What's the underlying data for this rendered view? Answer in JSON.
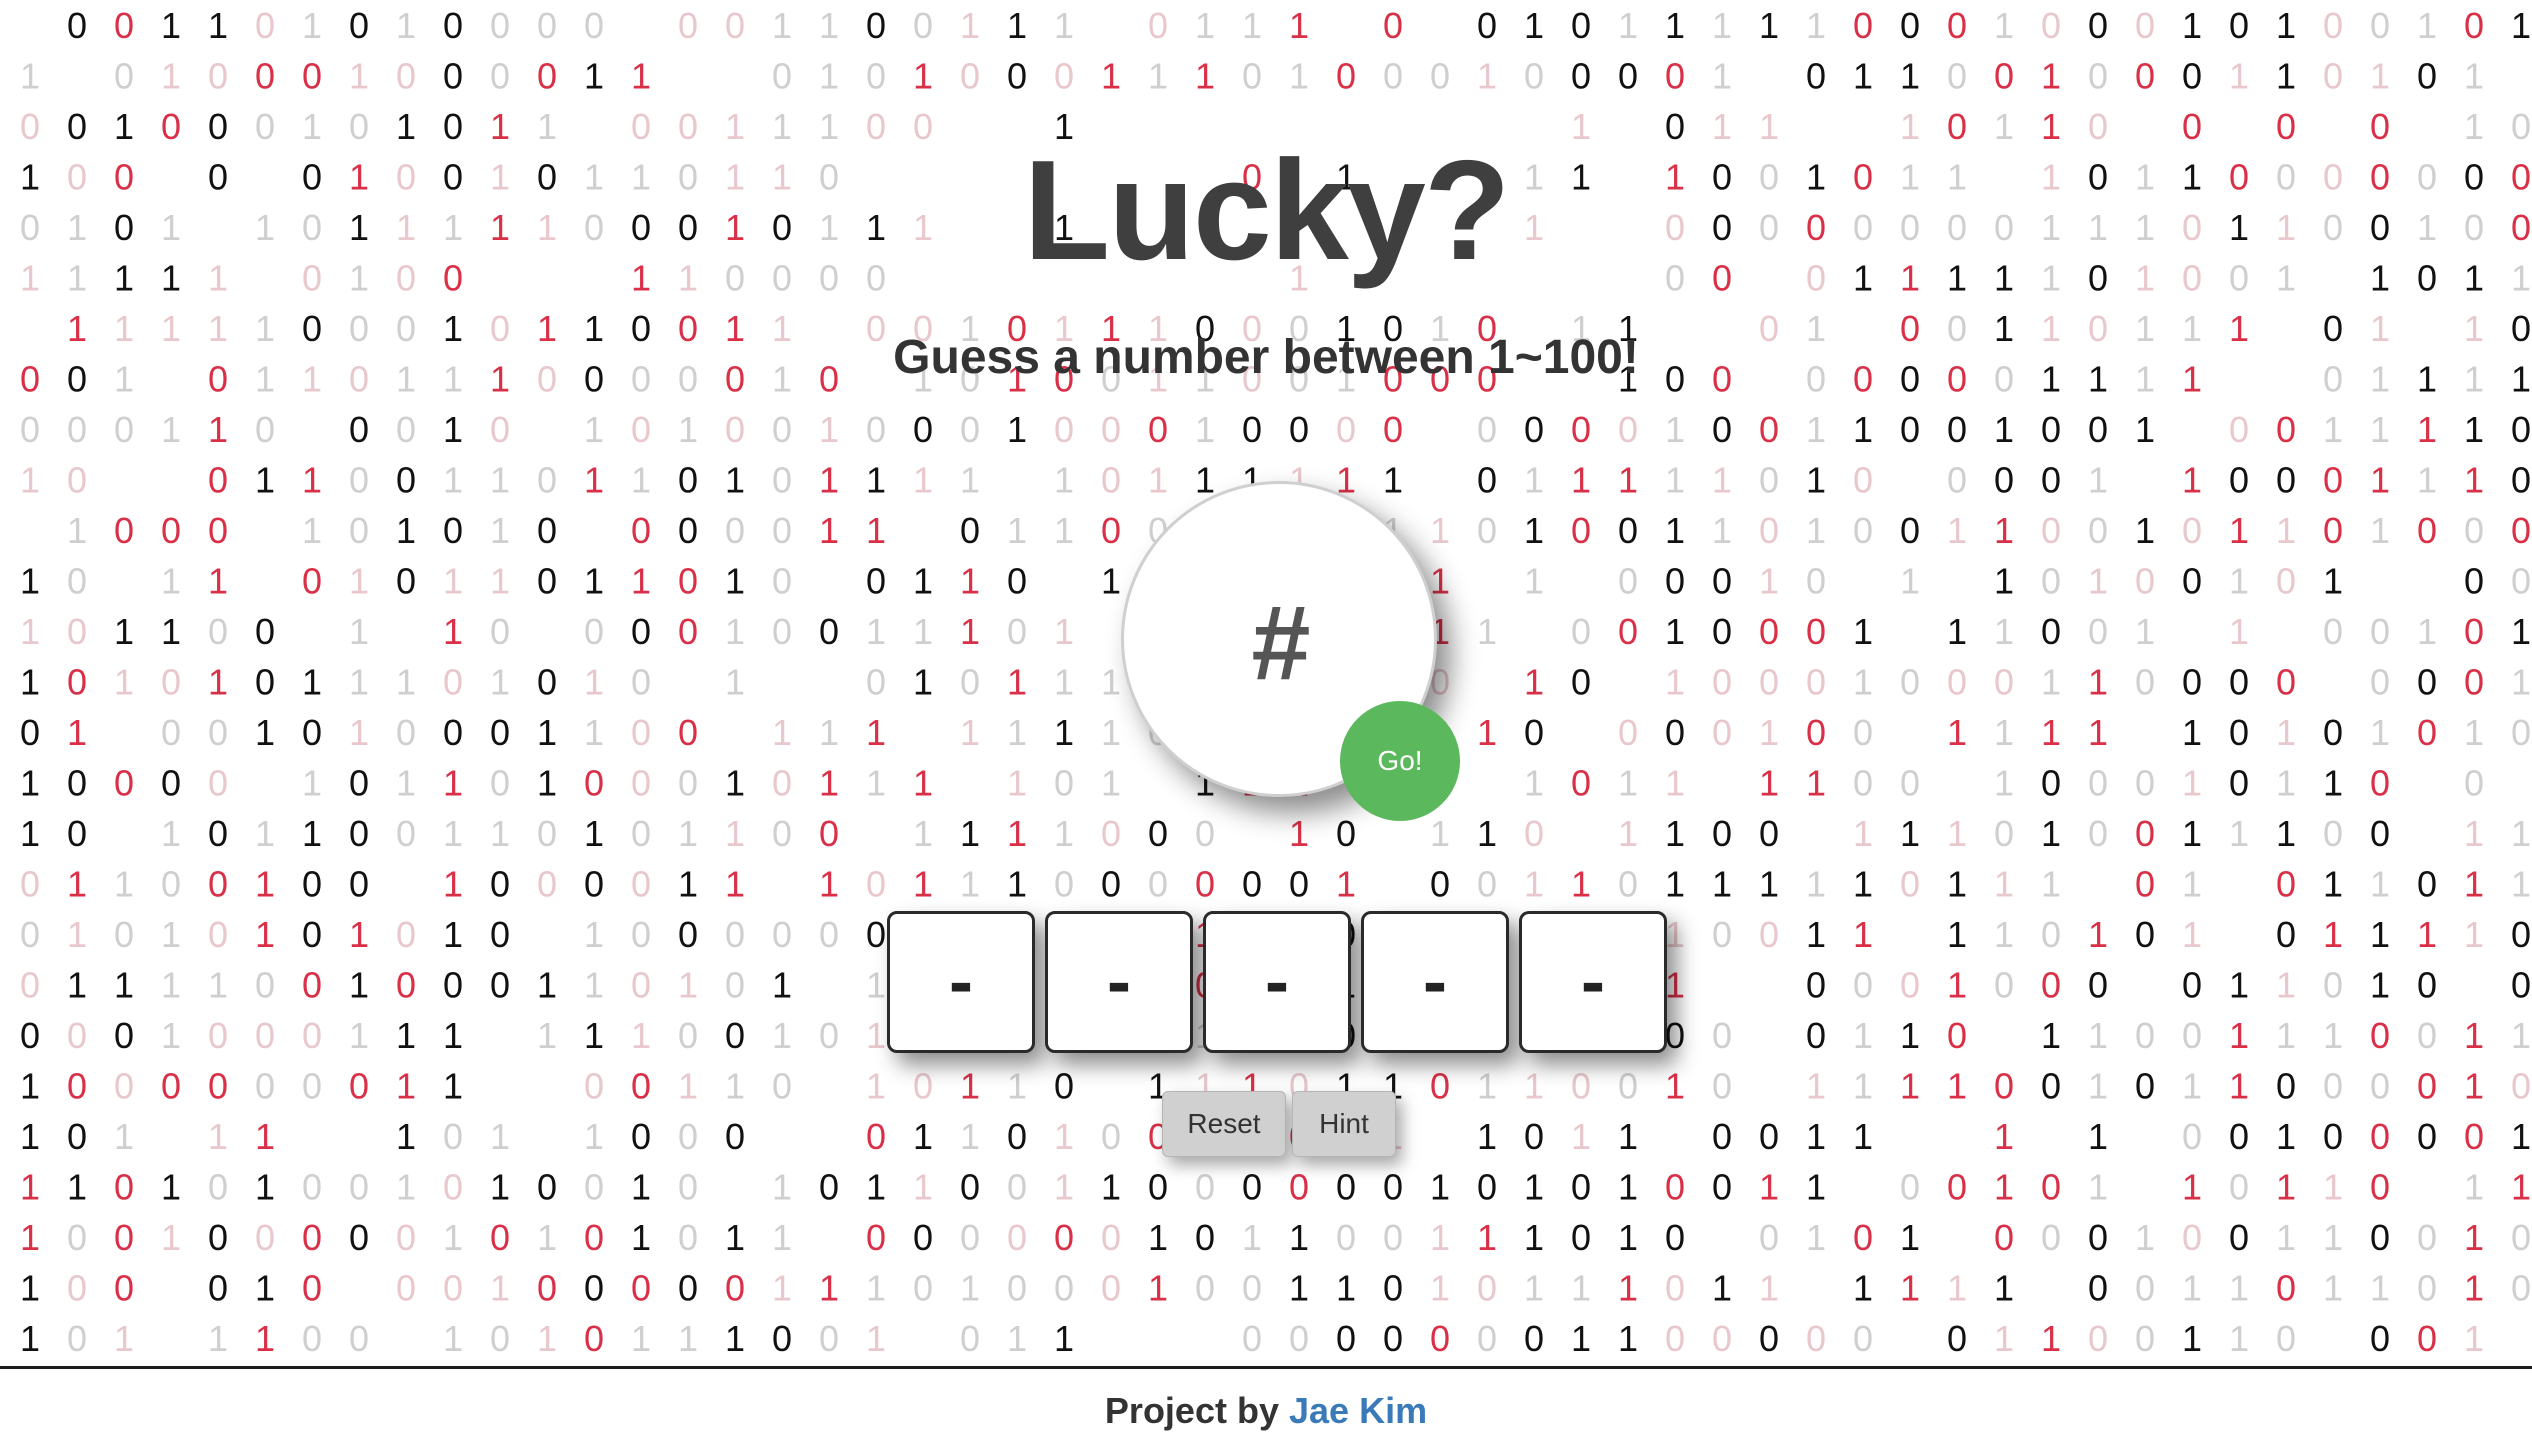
{
  "app": {
    "title": "Lucky?",
    "subtitle": "Guess a number between 1~100!"
  },
  "guess": {
    "placeholder": "#",
    "go_label": "Go!",
    "go_color": "#5cb85c"
  },
  "attempts": {
    "slots": [
      "-",
      "-",
      "-",
      "-",
      "-"
    ]
  },
  "controls": {
    "reset_label": "Reset",
    "hint_label": "Hint"
  },
  "footer": {
    "prefix": "Project by",
    "author": "Jae Kim"
  },
  "background": {
    "pattern": "binary-digits",
    "digit_colors": [
      "#111111",
      "#cfcfcf",
      "#e8c8cc",
      "#d93048"
    ]
  }
}
